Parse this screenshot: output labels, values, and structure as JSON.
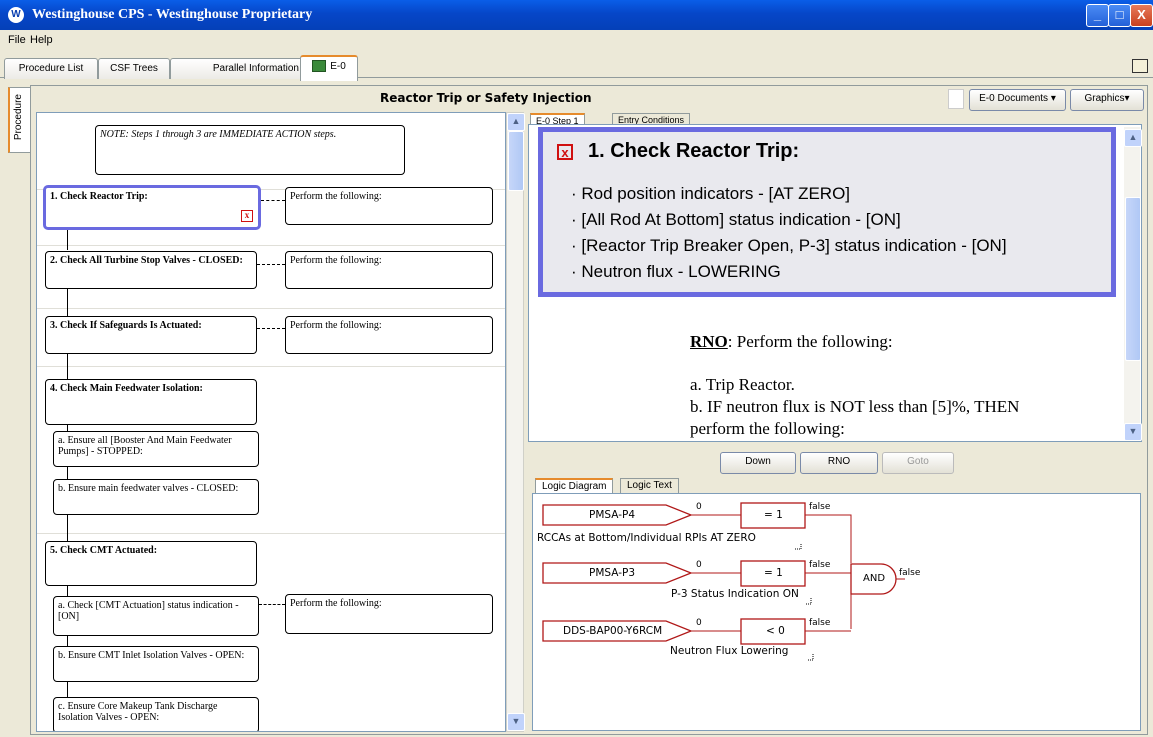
{
  "window": {
    "title": "Westinghouse CPS - Westinghouse Proprietary",
    "icon": "W",
    "min": "_",
    "max": "□",
    "close": "X"
  },
  "menu": [
    "File",
    "Help"
  ],
  "tabs": [
    {
      "label": "Procedure List"
    },
    {
      "label": "CSF Trees"
    },
    {
      "label": "Parallel Information"
    },
    {
      "label": "E-0",
      "active": true
    }
  ],
  "side_tab": "Procedure",
  "procedure": {
    "title": "Reactor Trip or Safety Injection",
    "documents_btn": "E-0 Documents",
    "graphics_btn": "Graphics"
  },
  "flowchart": {
    "note": "NOTE:   Steps 1 through 3 are IMMEDIATE ACTION steps.",
    "steps": [
      {
        "label": "1. Check Reactor Trip:",
        "rno": "Perform the following:"
      },
      {
        "label": "2.  Check  All  Turbine  Stop  Valves  - CLOSED:",
        "rno": "Perform the following:"
      },
      {
        "label": "3. Check If Safeguards Is Actuated:",
        "rno": "Perform the following:"
      },
      {
        "label": "4. Check Main Feedwater Isolation:"
      },
      {
        "label": "5. Check CMT Actuated:"
      }
    ],
    "substeps4": [
      "a. Ensure all [Booster And Main Feedwater Pumps] - STOPPED:",
      "b.  Ensure  main  feedwater  valves  - CLOSED:"
    ],
    "substeps5": [
      {
        "label": "a. Check [CMT Actuation] status indication - [ON]",
        "rno": "Perform the following:"
      },
      {
        "label": "b.  Ensure  CMT  Inlet  Isolation  Valves  - OPEN:"
      },
      {
        "label": "c.  Ensure  Core  Makeup  Tank  Discharge Isolation Valves - OPEN:"
      }
    ]
  },
  "step_tabs": [
    "E-0 Step 1",
    "Entry Conditions"
  ],
  "step_detail": {
    "title": "1. Check Reactor Trip:",
    "bullets": [
      "· Rod position indicators - [AT ZERO]",
      "· [All Rod At Bottom] status indication - [ON]",
      "· [Reactor Trip Breaker Open, P-3] status indication - [ON]",
      "· Neutron flux - LOWERING"
    ],
    "rno_label": "RNO",
    "rno_text": ": Perform the following:",
    "rno_items": [
      "a. Trip Reactor.",
      "b. IF neutron flux is NOT less than [5]%, THEN",
      "perform the following:"
    ]
  },
  "nav_buttons": [
    "Down",
    "RNO",
    "Goto"
  ],
  "logic_tabs": [
    "Logic Diagram",
    "Logic Text"
  ],
  "logic": {
    "inputs": [
      {
        "tag": "PMSA-P4",
        "value": "0",
        "compare": "= 1",
        "result": "false",
        "desc": "RCCAs at Bottom/Individual RPIs AT ZERO"
      },
      {
        "tag": "PMSA-P3",
        "value": "0",
        "compare": "= 1",
        "result": "false",
        "desc": "P-3 Status Indication ON"
      },
      {
        "tag": "DDS-BAP00-Y6RCM",
        "value": "0",
        "compare": "< 0",
        "result": "false",
        "desc": "Neutron Flux Lowering"
      }
    ],
    "gate": "AND",
    "gate_result": "false",
    "dots": "..."
  },
  "colors": {
    "accent": "#6a6ae0",
    "logic_red": "#b01818",
    "title_blue": "#0a5ee8",
    "tab_orange": "#e68b2c"
  }
}
